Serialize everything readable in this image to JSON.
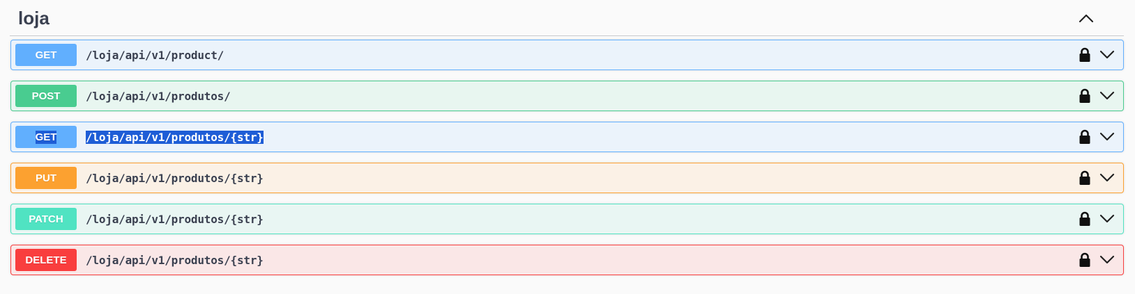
{
  "tag": {
    "title": "loja",
    "collapse_icon": "chevron-up-icon"
  },
  "operations": [
    {
      "method": "GET",
      "path": "/loja/api/v1/product/",
      "border": "#61affe",
      "bg": "#ebf3fb",
      "method_color": "#61affe"
    },
    {
      "method": "POST",
      "path": "/loja/api/v1/produtos/",
      "border": "#49cc90",
      "bg": "#e8f6f0",
      "method_color": "#49cc90"
    },
    {
      "method": "GET",
      "path": "/loja/api/v1/produtos/{str}",
      "border": "#61affe",
      "bg": "#ebf3fb",
      "method_color": "#61affe"
    },
    {
      "method": "PUT",
      "path": "/loja/api/v1/produtos/{str}",
      "border": "#fca130",
      "bg": "#fbf1e6",
      "method_color": "#fca130"
    },
    {
      "method": "PATCH",
      "path": "/loja/api/v1/produtos/{str}",
      "border": "#50e3c2",
      "bg": "#e9f6f3",
      "method_color": "#50e3c2"
    },
    {
      "method": "DELETE",
      "path": "/loja/api/v1/produtos/{str}",
      "border": "#f93e3e",
      "bg": "#fae7e7",
      "method_color": "#f93e3e"
    }
  ]
}
